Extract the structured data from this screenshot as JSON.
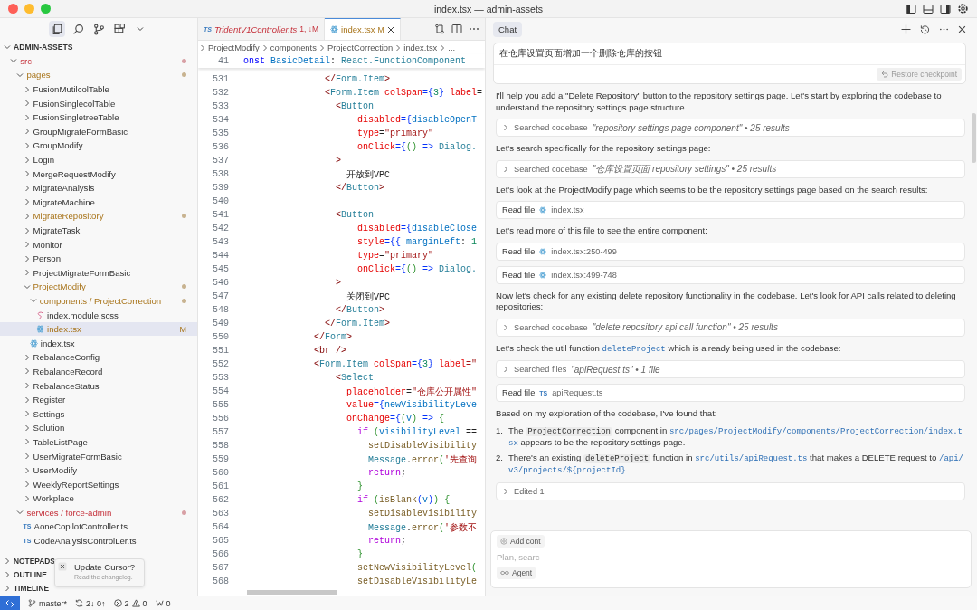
{
  "window": {
    "title": "index.tsx — admin-assets"
  },
  "activity_bar": [
    {
      "selected": true
    },
    {
      "selected": false
    },
    {
      "selected": false
    },
    {
      "selected": false
    },
    {
      "selected": false
    }
  ],
  "explorer": {
    "title": "ADMIN-ASSETS",
    "expanded": true,
    "tree": [
      {
        "label": "src",
        "kind": "folder",
        "has_problems": true,
        "expanded": true,
        "selected": false,
        "children": [
          {
            "label": "pages",
            "kind": "folder",
            "modified": true,
            "expanded": true,
            "selected": false,
            "children": [
              {
                "label": "FusionMutilcolTable",
                "kind": "folder",
                "expanded": false,
                "selected": false
              },
              {
                "label": "FusionSinglecolTable",
                "kind": "folder",
                "expanded": false,
                "selected": false
              },
              {
                "label": "FusionSingletreeTable",
                "kind": "folder",
                "expanded": false,
                "selected": false
              },
              {
                "label": "GroupMigrateFormBasic",
                "kind": "folder",
                "expanded": false,
                "selected": false
              },
              {
                "label": "GroupModify",
                "kind": "folder",
                "expanded": false,
                "selected": false
              },
              {
                "label": "Login",
                "kind": "folder",
                "expanded": false,
                "selected": false
              },
              {
                "label": "MergeRequestModify",
                "kind": "folder",
                "expanded": false,
                "selected": false
              },
              {
                "label": "MigrateAnalysis",
                "kind": "folder",
                "expanded": false,
                "selected": false
              },
              {
                "label": "MigrateMachine",
                "kind": "folder",
                "expanded": false,
                "selected": false
              },
              {
                "label": "MigrateRepository",
                "kind": "folder",
                "modified": true,
                "expanded": false,
                "selected": false
              },
              {
                "label": "MigrateTask",
                "kind": "folder",
                "expanded": false,
                "selected": false
              },
              {
                "label": "Monitor",
                "kind": "folder",
                "expanded": false,
                "selected": false
              },
              {
                "label": "Person",
                "kind": "folder",
                "expanded": false,
                "selected": false
              },
              {
                "label": "ProjectMigrateFormBasic",
                "kind": "folder",
                "expanded": false,
                "selected": false
              },
              {
                "label": "ProjectModify",
                "kind": "folder",
                "modified": true,
                "expanded": true,
                "selected": false,
                "children": [
                  {
                    "label": "components / ProjectCorrection",
                    "kind": "folder",
                    "modified": true,
                    "expanded": true,
                    "selected": false,
                    "children": [
                      {
                        "label": "index.module.scss",
                        "kind": "scss",
                        "selected": false
                      },
                      {
                        "label": "index.tsx",
                        "kind": "tsx",
                        "modified": true,
                        "badge": "M",
                        "selected": true
                      }
                    ]
                  },
                  {
                    "label": "index.tsx",
                    "kind": "tsx",
                    "selected": false
                  }
                ]
              },
              {
                "label": "RebalanceConfig",
                "kind": "folder",
                "expanded": false,
                "selected": false
              },
              {
                "label": "RebalanceRecord",
                "kind": "folder",
                "expanded": false,
                "selected": false
              },
              {
                "label": "RebalanceStatus",
                "kind": "folder",
                "expanded": false,
                "selected": false
              },
              {
                "label": "Register",
                "kind": "folder",
                "expanded": false,
                "selected": false
              },
              {
                "label": "Settings",
                "kind": "folder",
                "expanded": false,
                "selected": false
              },
              {
                "label": "Solution",
                "kind": "folder",
                "expanded": false,
                "selected": false
              },
              {
                "label": "TableListPage",
                "kind": "folder",
                "expanded": false,
                "selected": false
              },
              {
                "label": "UserMigrateFormBasic",
                "kind": "folder",
                "expanded": false,
                "selected": false
              },
              {
                "label": "UserModify",
                "kind": "folder",
                "expanded": false,
                "selected": false
              },
              {
                "label": "WeeklyReportSettings",
                "kind": "folder",
                "expanded": false,
                "selected": false
              },
              {
                "label": "Workplace",
                "kind": "folder",
                "expanded": false,
                "selected": false
              }
            ]
          },
          {
            "label": "services / force-admin",
            "kind": "folder",
            "has_problems": true,
            "expanded": true,
            "selected": false,
            "children": [
              {
                "label": "AoneCopilotController.ts",
                "kind": "ts",
                "icon": "TS",
                "selected": false
              },
              {
                "label": "CodeAnalysisControlLer.ts",
                "kind": "ts",
                "icon": "TS",
                "selected": false
              }
            ]
          }
        ]
      }
    ]
  },
  "sections": [
    {
      "label": "NOTEPADS",
      "expanded": false
    },
    {
      "label": "OUTLINE",
      "expanded": false
    },
    {
      "label": "TIMELINE",
      "expanded": false
    }
  ],
  "notification": {
    "title": "Update Cursor?",
    "message": "Read the changelog."
  },
  "editor": {
    "tabs": [
      {
        "icon": "TS",
        "label": "TridentV1Controller.ts",
        "badge": "1, ↓M",
        "has_problems": true,
        "selected": false
      },
      {
        "label": "index.tsx",
        "badge": "M",
        "modified": true,
        "selected": true
      }
    ],
    "breadcrumb": [
      "ProjectModify",
      "components",
      "ProjectCorrection",
      "index.tsx",
      "..."
    ],
    "sticky": {
      "n": "41",
      "tokens": [
        {
          "text": "onst",
          "kind": "keyword"
        },
        {
          "text": " BasicDetail",
          "kind": "variable"
        },
        {
          "text": ": ",
          "kind": "plain"
        },
        {
          "text": "React.FunctionComponent",
          "kind": "type"
        }
      ]
    },
    "lines": [
      {
        "n": "531",
        "tokens": [
          {
            "text": "               </",
            "kind": "bracket"
          },
          {
            "text": "Form.Item",
            "kind": "type"
          },
          {
            "text": ">",
            "kind": "bracket"
          }
        ]
      },
      {
        "n": "532",
        "tokens": [
          {
            "text": "               <",
            "kind": "bracket"
          },
          {
            "text": "Form.Item",
            "kind": "type"
          },
          {
            "text": " colSpan",
            "kind": "attr"
          },
          {
            "text": "={",
            "kind": "brace"
          },
          {
            "text": "3",
            "kind": "number"
          },
          {
            "text": "}",
            "kind": "brace"
          },
          {
            "text": " label",
            "kind": "attr"
          },
          {
            "text": "=",
            "kind": "plain"
          }
        ]
      },
      {
        "n": "533",
        "tokens": [
          {
            "text": "                 <",
            "kind": "bracket"
          },
          {
            "text": "Button",
            "kind": "type"
          }
        ]
      },
      {
        "n": "534",
        "tokens": [
          {
            "text": "                     disabled",
            "kind": "attr"
          },
          {
            "text": "={",
            "kind": "brace"
          },
          {
            "text": "disableOpenT",
            "kind": "variable"
          }
        ]
      },
      {
        "n": "535",
        "tokens": [
          {
            "text": "                     type",
            "kind": "attr"
          },
          {
            "text": "=",
            "kind": "plain"
          },
          {
            "text": "\"primary\"",
            "kind": "string"
          }
        ]
      },
      {
        "n": "536",
        "tokens": [
          {
            "text": "                     onClick",
            "kind": "attr"
          },
          {
            "text": "={",
            "kind": "brace"
          },
          {
            "text": "()",
            "kind": "paren"
          },
          {
            "text": " =>",
            "kind": "brace"
          },
          {
            "text": " Dialog.",
            "kind": "type"
          }
        ]
      },
      {
        "n": "537",
        "tokens": [
          {
            "text": "                 >",
            "kind": "bracket"
          }
        ]
      },
      {
        "n": "538",
        "tokens": [
          {
            "text": "                   开放到VPC",
            "kind": "plain"
          }
        ]
      },
      {
        "n": "539",
        "tokens": [
          {
            "text": "                 </",
            "kind": "bracket"
          },
          {
            "text": "Button",
            "kind": "type"
          },
          {
            "text": ">",
            "kind": "bracket"
          }
        ]
      },
      {
        "n": "540"
      },
      {
        "n": "541",
        "tokens": [
          {
            "text": "                 <",
            "kind": "bracket"
          },
          {
            "text": "Button",
            "kind": "type"
          }
        ]
      },
      {
        "n": "542",
        "tokens": [
          {
            "text": "                     disabled",
            "kind": "attr"
          },
          {
            "text": "={",
            "kind": "brace"
          },
          {
            "text": "disableClose",
            "kind": "variable"
          }
        ]
      },
      {
        "n": "543",
        "tokens": [
          {
            "text": "                     style",
            "kind": "attr"
          },
          {
            "text": "={{",
            "kind": "brace"
          },
          {
            "text": " marginLeft",
            "kind": "variable"
          },
          {
            "text": ": ",
            "kind": "plain"
          },
          {
            "text": "1",
            "kind": "number"
          }
        ]
      },
      {
        "n": "544",
        "tokens": [
          {
            "text": "                     type",
            "kind": "attr"
          },
          {
            "text": "=",
            "kind": "plain"
          },
          {
            "text": "\"primary\"",
            "kind": "string"
          }
        ]
      },
      {
        "n": "545",
        "tokens": [
          {
            "text": "                     onClick",
            "kind": "attr"
          },
          {
            "text": "={",
            "kind": "brace"
          },
          {
            "text": "()",
            "kind": "paren"
          },
          {
            "text": " =>",
            "kind": "brace"
          },
          {
            "text": " Dialog.",
            "kind": "type"
          }
        ]
      },
      {
        "n": "546",
        "tokens": [
          {
            "text": "                 >",
            "kind": "bracket"
          }
        ]
      },
      {
        "n": "547",
        "tokens": [
          {
            "text": "                   关闭到VPC",
            "kind": "plain"
          }
        ]
      },
      {
        "n": "548",
        "tokens": [
          {
            "text": "                 </",
            "kind": "bracket"
          },
          {
            "text": "Button",
            "kind": "type"
          },
          {
            "text": ">",
            "kind": "bracket"
          }
        ]
      },
      {
        "n": "549",
        "tokens": [
          {
            "text": "               </",
            "kind": "bracket"
          },
          {
            "text": "Form.Item",
            "kind": "type"
          },
          {
            "text": ">",
            "kind": "bracket"
          }
        ]
      },
      {
        "n": "550",
        "tokens": [
          {
            "text": "             </",
            "kind": "bracket"
          },
          {
            "text": "Form",
            "kind": "type"
          },
          {
            "text": ">",
            "kind": "bracket"
          }
        ]
      },
      {
        "n": "551",
        "tokens": [
          {
            "text": "             <br />",
            "kind": "bracket"
          }
        ]
      },
      {
        "n": "552",
        "tokens": [
          {
            "text": "             <",
            "kind": "bracket"
          },
          {
            "text": "Form.Item",
            "kind": "type"
          },
          {
            "text": " colSpan",
            "kind": "attr"
          },
          {
            "text": "={",
            "kind": "brace"
          },
          {
            "text": "3",
            "kind": "number"
          },
          {
            "text": "}",
            "kind": "brace"
          },
          {
            "text": " label",
            "kind": "attr"
          },
          {
            "text": "=\"",
            "kind": "string"
          }
        ]
      },
      {
        "n": "553",
        "tokens": [
          {
            "text": "                 <",
            "kind": "bracket"
          },
          {
            "text": "Select",
            "kind": "type"
          }
        ]
      },
      {
        "n": "554",
        "tokens": [
          {
            "text": "                   placeholder",
            "kind": "attr"
          },
          {
            "text": "=",
            "kind": "plain"
          },
          {
            "text": "\"仓库公开属性\"",
            "kind": "string"
          }
        ]
      },
      {
        "n": "555",
        "tokens": [
          {
            "text": "                   value",
            "kind": "attr"
          },
          {
            "text": "={",
            "kind": "brace"
          },
          {
            "text": "newVisibilityLeve",
            "kind": "variable"
          }
        ]
      },
      {
        "n": "556",
        "tokens": [
          {
            "text": "                   onChange",
            "kind": "attr"
          },
          {
            "text": "={",
            "kind": "brace"
          },
          {
            "text": "(",
            "kind": "paren"
          },
          {
            "text": "v",
            "kind": "variable"
          },
          {
            "text": ")",
            "kind": "paren"
          },
          {
            "text": " =>",
            "kind": "brace"
          },
          {
            "text": " {",
            "kind": "paren"
          }
        ]
      },
      {
        "n": "557",
        "tokens": [
          {
            "text": "                     if",
            "kind": "keyword2"
          },
          {
            "text": " (",
            "kind": "paren"
          },
          {
            "text": "visibilityLevel",
            "kind": "variable"
          },
          {
            "text": " ==",
            "kind": "plain"
          }
        ]
      },
      {
        "n": "558",
        "tokens": [
          {
            "text": "                       setDisableVisibility",
            "kind": "function"
          }
        ]
      },
      {
        "n": "559",
        "tokens": [
          {
            "text": "                       Message",
            "kind": "type"
          },
          {
            "text": ".",
            "kind": "plain"
          },
          {
            "text": "error",
            "kind": "function"
          },
          {
            "text": "(",
            "kind": "paren"
          },
          {
            "text": "'先查询",
            "kind": "string"
          }
        ]
      },
      {
        "n": "560",
        "tokens": [
          {
            "text": "                       return",
            "kind": "keyword2"
          },
          {
            "text": ";",
            "kind": "plain"
          }
        ]
      },
      {
        "n": "561",
        "tokens": [
          {
            "text": "                     }",
            "kind": "paren"
          }
        ]
      },
      {
        "n": "562",
        "tokens": [
          {
            "text": "                     if",
            "kind": "keyword2"
          },
          {
            "text": " (",
            "kind": "paren"
          },
          {
            "text": "isBlank",
            "kind": "function"
          },
          {
            "text": "(",
            "kind": "brace"
          },
          {
            "text": "v",
            "kind": "variable"
          },
          {
            "text": ")",
            "kind": "brace"
          },
          {
            "text": ")",
            "kind": "paren"
          },
          {
            "text": " {",
            "kind": "paren"
          }
        ]
      },
      {
        "n": "563",
        "tokens": [
          {
            "text": "                       setDisableVisibility",
            "kind": "function"
          }
        ]
      },
      {
        "n": "564",
        "tokens": [
          {
            "text": "                       Message",
            "kind": "type"
          },
          {
            "text": ".",
            "kind": "plain"
          },
          {
            "text": "error",
            "kind": "function"
          },
          {
            "text": "(",
            "kind": "paren"
          },
          {
            "text": "'参数不",
            "kind": "string"
          }
        ]
      },
      {
        "n": "565",
        "tokens": [
          {
            "text": "                       return",
            "kind": "keyword2"
          },
          {
            "text": ";",
            "kind": "plain"
          }
        ]
      },
      {
        "n": "566",
        "tokens": [
          {
            "text": "                     }",
            "kind": "paren"
          }
        ]
      },
      {
        "n": "567",
        "tokens": [
          {
            "text": "                     setNewVisibilityLevel",
            "kind": "function"
          },
          {
            "text": "(",
            "kind": "paren"
          }
        ]
      },
      {
        "n": "568",
        "tokens": [
          {
            "text": "                     setDisableVisibilityLe",
            "kind": "function"
          }
        ]
      }
    ]
  },
  "chat": {
    "tabs": [
      {
        "label": "Chat",
        "selected": true
      }
    ],
    "prompt": "在仓库设置页面增加一个删除仓库的按钮",
    "restore": "Restore checkpoint",
    "messages": [
      {
        "kind": "text",
        "text": "I'll help you add a \"Delete Repository\" button to the repository settings page. Let's start by exploring the codebase to understand the repository settings page structure."
      },
      {
        "kind": "tool",
        "label": "Searched codebase",
        "detail": "\"repository settings page component\" • 25 results",
        "expanded": false
      },
      {
        "kind": "text",
        "text": "Let's search specifically for the repository settings page:"
      },
      {
        "kind": "tool",
        "label": "Searched codebase",
        "detail": "\"仓库设置页面 repository settings\" • 25 results",
        "expanded": false
      },
      {
        "kind": "text",
        "text": "Let's look at the ProjectModify page which seems to be the repository settings page based on the search results:"
      },
      {
        "kind": "read",
        "label": "Read file",
        "file": "index.tsx"
      },
      {
        "kind": "text",
        "text": "Let's read more of this file to see the entire component:"
      },
      {
        "kind": "read",
        "label": "Read file",
        "file": "index.tsx:250-499"
      },
      {
        "kind": "read",
        "label": "Read file",
        "file": "index.tsx:499-748"
      },
      {
        "kind": "text",
        "text": "Now let's check for any existing delete repository functionality in the codebase. Let's look for API calls related to deleting repositories:"
      },
      {
        "kind": "tool",
        "label": "Searched codebase",
        "detail": "\"delete repository api call function\" • 25 results",
        "expanded": false
      },
      {
        "kind": "rich",
        "segments": [
          {
            "text": "Let's check the util function ",
            "kind": "plain"
          },
          {
            "text": "deleteProject",
            "kind": "path"
          },
          {
            "text": " which is already being used in the codebase:",
            "kind": "plain"
          }
        ]
      },
      {
        "kind": "tool",
        "label": "Searched files",
        "detail": "\"apiRequest.ts\" • 1 file",
        "expanded": false
      },
      {
        "kind": "read",
        "label": "Read file",
        "file": "apiRequest.ts",
        "icon": "TS"
      },
      {
        "kind": "text",
        "text": "Based on my exploration of the codebase, I've found that:"
      },
      {
        "kind": "list",
        "items": [
          {
            "marker": "1.",
            "segments": [
              {
                "text": "The ",
                "kind": "plain"
              },
              {
                "text": "ProjectCorrection",
                "kind": "code"
              },
              {
                "text": " component in ",
                "kind": "plain"
              },
              {
                "text": "src/pages/ProjectModify/components/ProjectCorrection/index.tsx",
                "kind": "path"
              },
              {
                "text": " appears to be the repository settings page.",
                "kind": "plain"
              }
            ]
          },
          {
            "marker": "2.",
            "segments": [
              {
                "text": "There's an existing ",
                "kind": "plain"
              },
              {
                "text": "deleteProject",
                "kind": "code"
              },
              {
                "text": " function in ",
                "kind": "plain"
              },
              {
                "text": "src/utils/apiRequest.ts",
                "kind": "path"
              },
              {
                "text": " that makes a DELETE request to ",
                "kind": "plain"
              },
              {
                "text": "/api/v3/projects/${projectId}",
                "kind": "path"
              },
              {
                "text": " .",
                "kind": "plain"
              }
            ]
          }
        ]
      },
      {
        "kind": "tool",
        "label": "Edited 1",
        "expanded": false
      }
    ],
    "composer": {
      "context": "Add cont",
      "placeholder": "Plan, searc",
      "mode": "Agent"
    }
  },
  "status_bar": {
    "branch": "master*",
    "sync": "2↓ 0↑",
    "errors": "2",
    "warnings": "0",
    "ports": "0"
  }
}
